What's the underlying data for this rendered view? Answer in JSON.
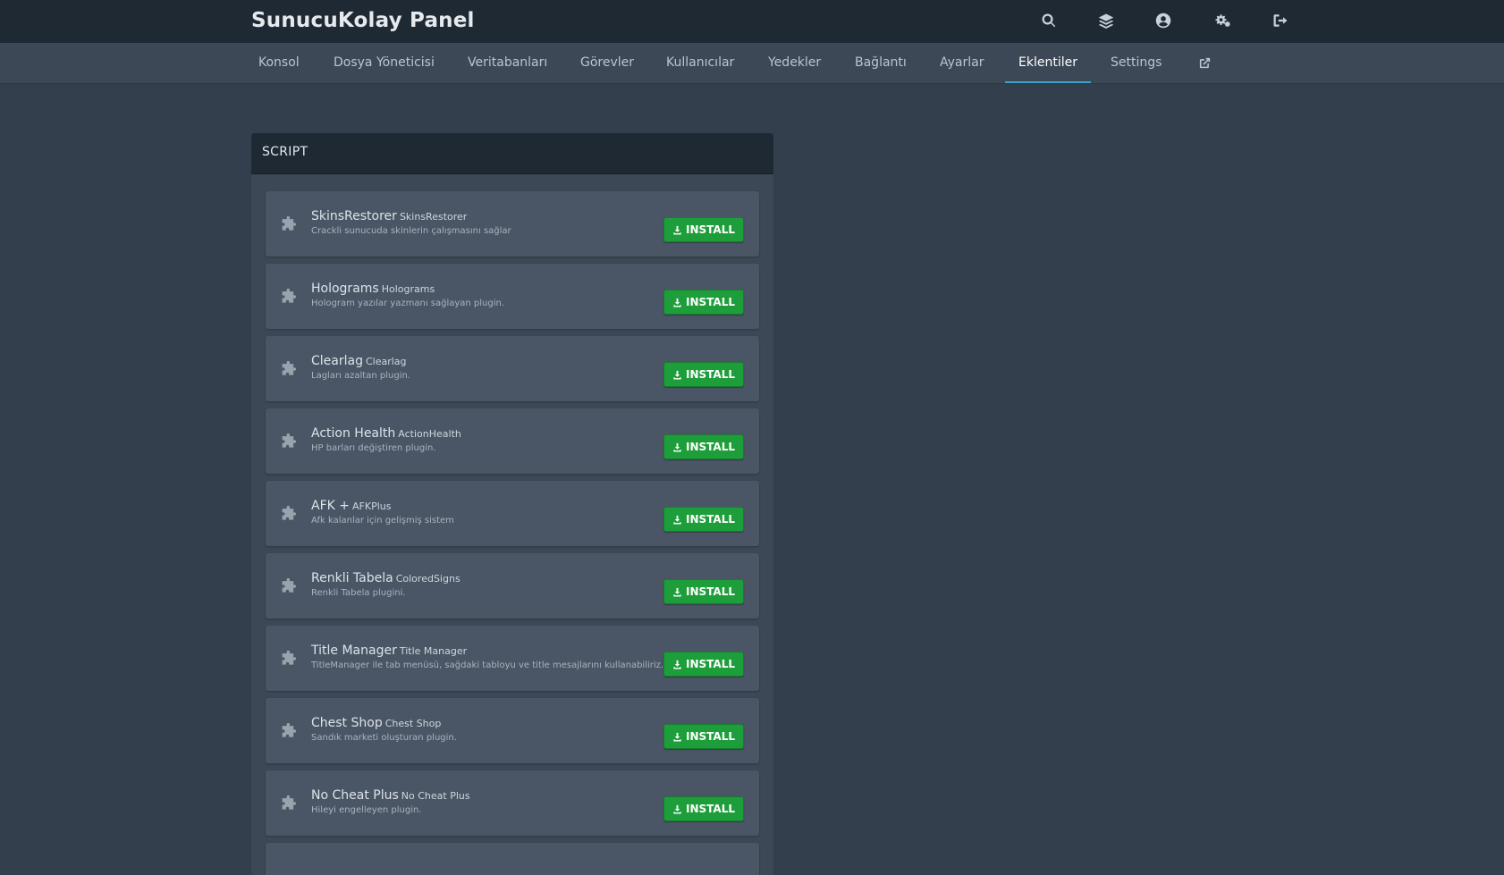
{
  "app": {
    "title": "SunucuKolay Panel"
  },
  "top_icons": [
    "search-icon",
    "layers-icon",
    "account-icon",
    "settings-icon",
    "logout-icon"
  ],
  "nav": {
    "items": [
      {
        "label": "Konsol"
      },
      {
        "label": "Dosya Yöneticisi"
      },
      {
        "label": "Veritabanları"
      },
      {
        "label": "Görevler"
      },
      {
        "label": "Kullanıcılar"
      },
      {
        "label": "Yedekler"
      },
      {
        "label": "Bağlantı"
      },
      {
        "label": "Ayarlar"
      },
      {
        "label": "Eklentiler",
        "active": true
      },
      {
        "label": "Settings"
      }
    ],
    "external_icon": "external-link-icon"
  },
  "panel": {
    "header": "SCRIPT"
  },
  "plugins": [
    {
      "name": "SkinsRestorer",
      "id": "SkinsRestorer",
      "description": "Crackli sunucuda skinlerin çalışmasını sağlar",
      "button": "INSTALL"
    },
    {
      "name": "Holograms",
      "id": "Holograms",
      "description": "Hologram yazılar yazmanı sağlayan plugin.",
      "button": "INSTALL"
    },
    {
      "name": "Clearlag",
      "id": "Clearlag",
      "description": "Lagları azaltan plugin.",
      "button": "INSTALL"
    },
    {
      "name": "Action Health",
      "id": "ActionHealth",
      "description": "HP barları değiştiren plugin.",
      "button": "INSTALL"
    },
    {
      "name": "AFK +",
      "id": "AFKPlus",
      "description": "Afk kalanlar için gelişmiş sistem",
      "button": "INSTALL"
    },
    {
      "name": "Renkli Tabela",
      "id": "ColoredSigns",
      "description": "Renkli Tabela plugini.",
      "button": "INSTALL"
    },
    {
      "name": "Title Manager",
      "id": "Title Manager",
      "description": "TitleManager ile tab menüsü, sağdaki tabloyu ve title mesajlarını kullanabiliriz.",
      "button": "INSTALL"
    },
    {
      "name": "Chest Shop",
      "id": "Chest Shop",
      "description": "Sandık marketi oluşturan plugin.",
      "button": "INSTALL"
    },
    {
      "name": "No Cheat Plus",
      "id": "No Cheat Plus",
      "description": "Hileyi engelleyen plugin.",
      "button": "INSTALL"
    },
    {
      "name": "",
      "id": "",
      "description": "",
      "button": ""
    }
  ],
  "colors": {
    "install_button": "#1e9e3b",
    "active_tab_underline": "#3ba5c9",
    "background": "#333f4d"
  }
}
